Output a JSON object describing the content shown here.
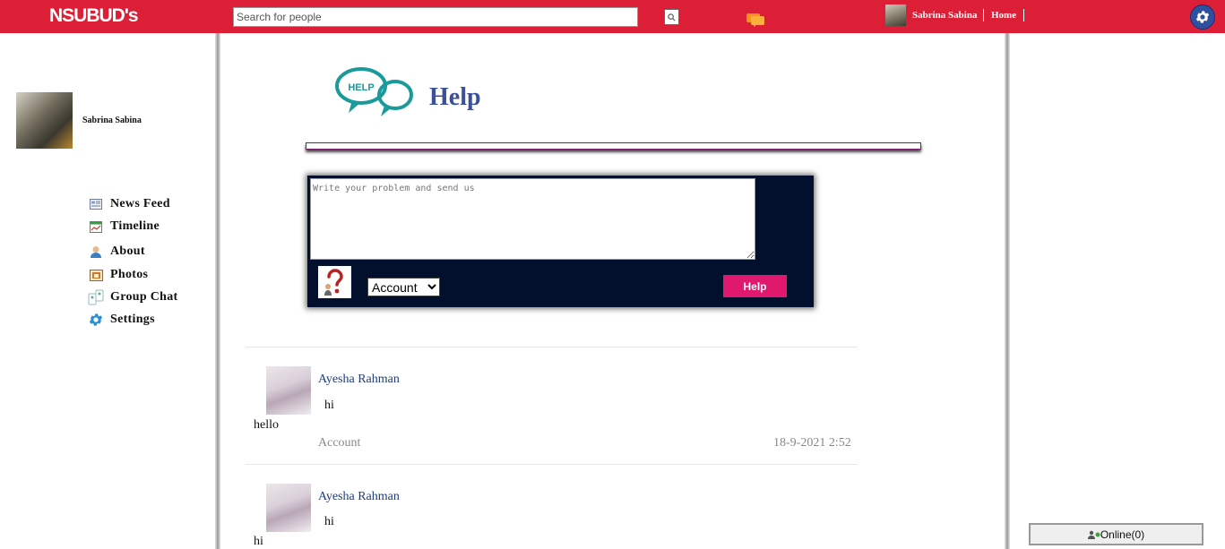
{
  "header": {
    "logo": "NSUBUD's",
    "search_placeholder": "Search for people",
    "user_name": "Sabrina Sabina",
    "home_label": "Home"
  },
  "sidebar": {
    "profile_name": "Sabrina Sabina",
    "items": [
      {
        "label": "News Feed",
        "icon": "news-feed-icon"
      },
      {
        "label": "Timeline",
        "icon": "timeline-icon"
      },
      {
        "label": "About",
        "icon": "about-icon"
      },
      {
        "label": "Photos",
        "icon": "photos-icon"
      },
      {
        "label": "Group Chat",
        "icon": "group-chat-icon"
      },
      {
        "label": "Settings",
        "icon": "settings-icon"
      }
    ]
  },
  "help": {
    "title": "Help",
    "logo_text": "HELP",
    "textarea_placeholder": "Write your problem and send us",
    "category_selected": "Account",
    "submit_label": "Help"
  },
  "posts": [
    {
      "author": "Ayesha Rahman",
      "subject": "hi",
      "body": "hello",
      "category": "Account",
      "time": "18-9-2021 2:52"
    },
    {
      "author": "Ayesha Rahman",
      "subject": "hi",
      "body": "hi"
    }
  ],
  "footer": {
    "online_label": "Online(0)"
  },
  "colors": {
    "topbar": "#dc1e36",
    "help_title": "#3b4f9a",
    "help_box": "#02102e",
    "help_button": "#e0186e",
    "author_link": "#1f3d7a"
  }
}
